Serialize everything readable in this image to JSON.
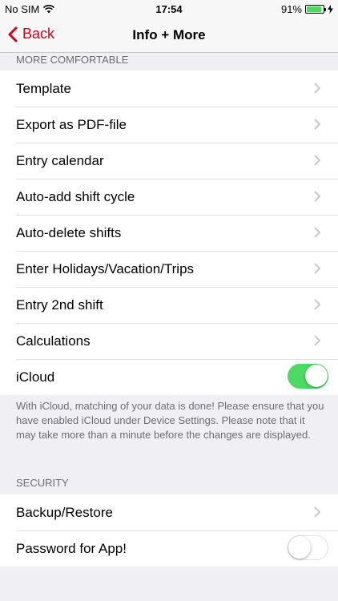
{
  "status_bar": {
    "carrier": "No SIM",
    "wifi_icon": "wifi-icon",
    "time": "17:54",
    "battery": "91%",
    "battery_level": 0.91,
    "charging_icon": "bolt-icon"
  },
  "nav": {
    "back_label": "Back",
    "title": "Info + More",
    "accent_color": "#d0021b"
  },
  "sections": {
    "comfortable": {
      "header": "MORE COMFORTABLE",
      "items": [
        {
          "label": "Template"
        },
        {
          "label": "Export as PDF-file"
        },
        {
          "label": "Entry calendar"
        },
        {
          "label": "Auto-add shift cycle"
        },
        {
          "label": "Auto-delete shifts"
        },
        {
          "label": "Enter Holidays/Vacation/Trips"
        },
        {
          "label": "Entry 2nd shift"
        },
        {
          "label": "Calculations"
        }
      ],
      "icloud": {
        "label": "iCloud",
        "enabled": true,
        "toggle_color": "#4cd964"
      },
      "footer": "With iCloud, matching of your data is done! Please ensure that you have enabled iCloud under Device Settings. Please note that it may take more than a minute before the changes are displayed."
    },
    "security": {
      "header": "SECURITY",
      "backup": {
        "label": "Backup/Restore"
      },
      "password": {
        "label": "Password for App!",
        "enabled": false
      }
    }
  }
}
